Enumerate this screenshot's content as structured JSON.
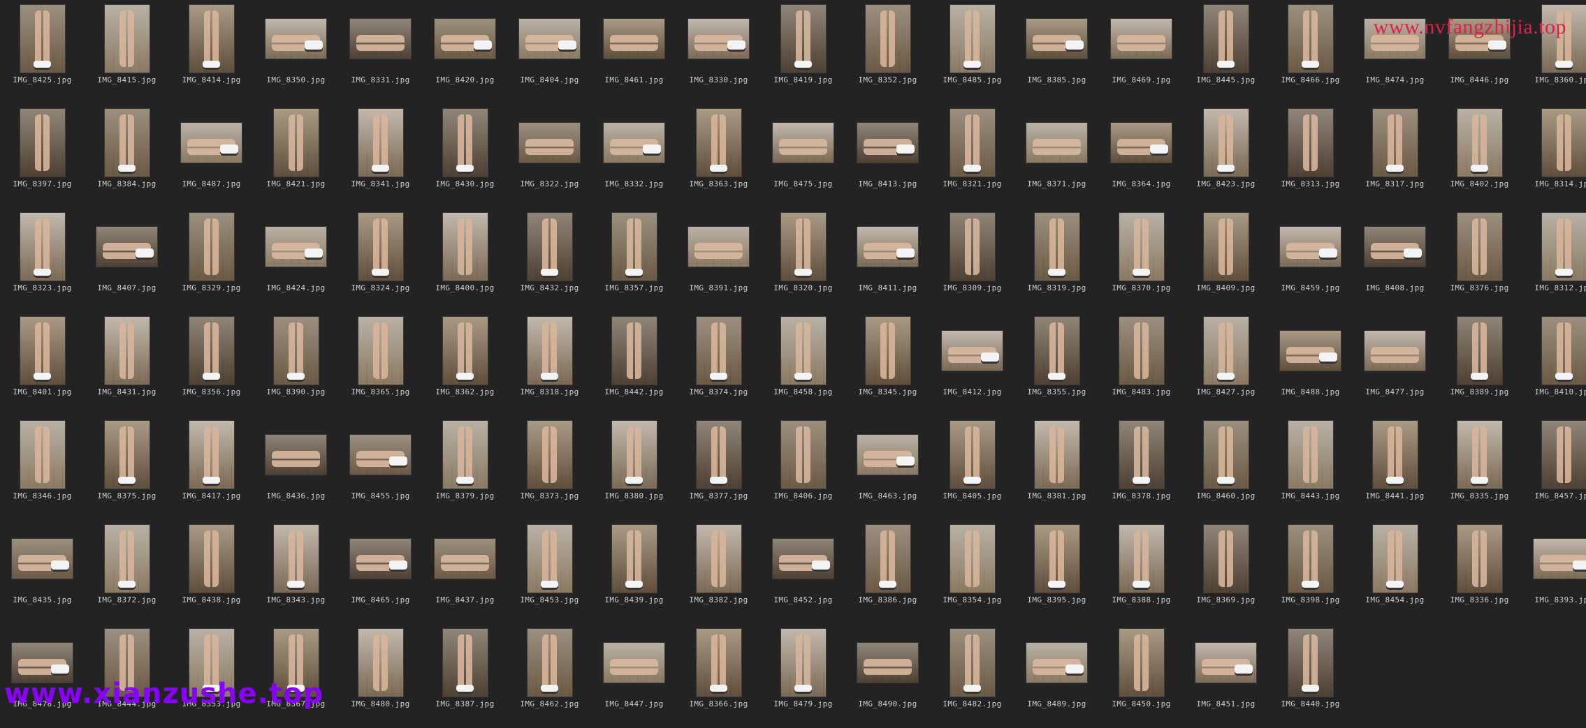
{
  "watermarks": {
    "top_right": "www.nvfangzhijia.top",
    "bottom_left": "www.xianzushe.top"
  },
  "colors": {
    "background": "#232323",
    "label_text": "#cfcfcf",
    "watermark_top": "#e0204a",
    "watermark_bottom": "#8a00ff"
  },
  "files": [
    {
      "name": "IMG_8425.jpg",
      "orientation": "portrait"
    },
    {
      "name": "IMG_8415.jpg",
      "orientation": "portrait"
    },
    {
      "name": "IMG_8414.jpg",
      "orientation": "portrait"
    },
    {
      "name": "IMG_8350.jpg",
      "orientation": "landscape"
    },
    {
      "name": "IMG_8331.jpg",
      "orientation": "landscape"
    },
    {
      "name": "IMG_8420.jpg",
      "orientation": "landscape"
    },
    {
      "name": "IMG_8404.jpg",
      "orientation": "landscape"
    },
    {
      "name": "IMG_8461.jpg",
      "orientation": "landscape"
    },
    {
      "name": "IMG_8330.jpg",
      "orientation": "landscape"
    },
    {
      "name": "IMG_8419.jpg",
      "orientation": "portrait"
    },
    {
      "name": "IMG_8352.jpg",
      "orientation": "portrait"
    },
    {
      "name": "IMG_8485.jpg",
      "orientation": "portrait"
    },
    {
      "name": "IMG_8385.jpg",
      "orientation": "landscape"
    },
    {
      "name": "IMG_8469.jpg",
      "orientation": "landscape"
    },
    {
      "name": "IMG_8445.jpg",
      "orientation": "portrait"
    },
    {
      "name": "IMG_8466.jpg",
      "orientation": "portrait"
    },
    {
      "name": "IMG_8474.jpg",
      "orientation": "landscape"
    },
    {
      "name": "IMG_8446.jpg",
      "orientation": "landscape"
    },
    {
      "name": "IMG_8360.jpg",
      "orientation": "portrait"
    },
    {
      "name": "IMG_8397.jpg",
      "orientation": "portrait"
    },
    {
      "name": "IMG_8384.jpg",
      "orientation": "portrait"
    },
    {
      "name": "IMG_8487.jpg",
      "orientation": "landscape"
    },
    {
      "name": "IMG_8421.jpg",
      "orientation": "portrait"
    },
    {
      "name": "IMG_8341.jpg",
      "orientation": "portrait"
    },
    {
      "name": "IMG_8430.jpg",
      "orientation": "portrait"
    },
    {
      "name": "IMG_8322.jpg",
      "orientation": "landscape"
    },
    {
      "name": "IMG_8332.jpg",
      "orientation": "landscape"
    },
    {
      "name": "IMG_8363.jpg",
      "orientation": "portrait"
    },
    {
      "name": "IMG_8475.jpg",
      "orientation": "landscape"
    },
    {
      "name": "IMG_8413.jpg",
      "orientation": "landscape"
    },
    {
      "name": "IMG_8321.jpg",
      "orientation": "portrait"
    },
    {
      "name": "IMG_8371.jpg",
      "orientation": "landscape"
    },
    {
      "name": "IMG_8364.jpg",
      "orientation": "landscape"
    },
    {
      "name": "IMG_8423.jpg",
      "orientation": "portrait"
    },
    {
      "name": "IMG_8313.jpg",
      "orientation": "portrait"
    },
    {
      "name": "IMG_8317.jpg",
      "orientation": "portrait"
    },
    {
      "name": "IMG_8402.jpg",
      "orientation": "portrait"
    },
    {
      "name": "IMG_8314.jpg",
      "orientation": "portrait"
    },
    {
      "name": "IMG_8323.jpg",
      "orientation": "portrait"
    },
    {
      "name": "IMG_8407.jpg",
      "orientation": "landscape"
    },
    {
      "name": "IMG_8329.jpg",
      "orientation": "portrait"
    },
    {
      "name": "IMG_8424.jpg",
      "orientation": "landscape"
    },
    {
      "name": "IMG_8324.jpg",
      "orientation": "portrait"
    },
    {
      "name": "IMG_8400.jpg",
      "orientation": "portrait"
    },
    {
      "name": "IMG_8432.jpg",
      "orientation": "portrait"
    },
    {
      "name": "IMG_8357.jpg",
      "orientation": "portrait"
    },
    {
      "name": "IMG_8391.jpg",
      "orientation": "landscape"
    },
    {
      "name": "IMG_8320.jpg",
      "orientation": "portrait"
    },
    {
      "name": "IMG_8411.jpg",
      "orientation": "landscape"
    },
    {
      "name": "IMG_8309.jpg",
      "orientation": "portrait"
    },
    {
      "name": "IMG_8319.jpg",
      "orientation": "portrait"
    },
    {
      "name": "IMG_8370.jpg",
      "orientation": "portrait"
    },
    {
      "name": "IMG_8409.jpg",
      "orientation": "portrait"
    },
    {
      "name": "IMG_8459.jpg",
      "orientation": "landscape"
    },
    {
      "name": "IMG_8408.jpg",
      "orientation": "landscape"
    },
    {
      "name": "IMG_8376.jpg",
      "orientation": "portrait"
    },
    {
      "name": "IMG_8312.jpg",
      "orientation": "portrait"
    },
    {
      "name": "IMG_8401.jpg",
      "orientation": "portrait"
    },
    {
      "name": "IMG_8431.jpg",
      "orientation": "portrait"
    },
    {
      "name": "IMG_8356.jpg",
      "orientation": "portrait"
    },
    {
      "name": "IMG_8390.jpg",
      "orientation": "portrait"
    },
    {
      "name": "IMG_8365.jpg",
      "orientation": "portrait"
    },
    {
      "name": "IMG_8362.jpg",
      "orientation": "portrait"
    },
    {
      "name": "IMG_8318.jpg",
      "orientation": "portrait"
    },
    {
      "name": "IMG_8442.jpg",
      "orientation": "portrait"
    },
    {
      "name": "IMG_8374.jpg",
      "orientation": "portrait"
    },
    {
      "name": "IMG_8458.jpg",
      "orientation": "portrait"
    },
    {
      "name": "IMG_8345.jpg",
      "orientation": "portrait"
    },
    {
      "name": "IMG_8412.jpg",
      "orientation": "landscape"
    },
    {
      "name": "IMG_8355.jpg",
      "orientation": "portrait"
    },
    {
      "name": "IMG_8483.jpg",
      "orientation": "portrait"
    },
    {
      "name": "IMG_8427.jpg",
      "orientation": "portrait"
    },
    {
      "name": "IMG_8488.jpg",
      "orientation": "landscape"
    },
    {
      "name": "IMG_8477.jpg",
      "orientation": "landscape"
    },
    {
      "name": "IMG_8389.jpg",
      "orientation": "portrait"
    },
    {
      "name": "IMG_8410.jpg",
      "orientation": "portrait"
    },
    {
      "name": "IMG_8346.jpg",
      "orientation": "portrait"
    },
    {
      "name": "IMG_8375.jpg",
      "orientation": "portrait"
    },
    {
      "name": "IMG_8417.jpg",
      "orientation": "portrait"
    },
    {
      "name": "IMG_8436.jpg",
      "orientation": "landscape"
    },
    {
      "name": "IMG_8455.jpg",
      "orientation": "landscape"
    },
    {
      "name": "IMG_8379.jpg",
      "orientation": "portrait"
    },
    {
      "name": "IMG_8373.jpg",
      "orientation": "portrait"
    },
    {
      "name": "IMG_8380.jpg",
      "orientation": "portrait"
    },
    {
      "name": "IMG_8377.jpg",
      "orientation": "portrait"
    },
    {
      "name": "IMG_8406.jpg",
      "orientation": "portrait"
    },
    {
      "name": "IMG_8463.jpg",
      "orientation": "landscape"
    },
    {
      "name": "IMG_8405.jpg",
      "orientation": "portrait"
    },
    {
      "name": "IMG_8381.jpg",
      "orientation": "portrait"
    },
    {
      "name": "IMG_8378.jpg",
      "orientation": "portrait"
    },
    {
      "name": "IMG_8460.jpg",
      "orientation": "portrait"
    },
    {
      "name": "IMG_8443.jpg",
      "orientation": "portrait"
    },
    {
      "name": "IMG_8441.jpg",
      "orientation": "portrait"
    },
    {
      "name": "IMG_8335.jpg",
      "orientation": "portrait"
    },
    {
      "name": "IMG_8457.jpg",
      "orientation": "portrait"
    },
    {
      "name": "IMG_8435.jpg",
      "orientation": "landscape"
    },
    {
      "name": "IMG_8372.jpg",
      "orientation": "portrait"
    },
    {
      "name": "IMG_8438.jpg",
      "orientation": "portrait"
    },
    {
      "name": "IMG_8343.jpg",
      "orientation": "portrait"
    },
    {
      "name": "IMG_8465.jpg",
      "orientation": "landscape"
    },
    {
      "name": "IMG_8437.jpg",
      "orientation": "landscape"
    },
    {
      "name": "IMG_8453.jpg",
      "orientation": "portrait"
    },
    {
      "name": "IMG_8439.jpg",
      "orientation": "portrait"
    },
    {
      "name": "IMG_8382.jpg",
      "orientation": "portrait"
    },
    {
      "name": "IMG_8452.jpg",
      "orientation": "landscape"
    },
    {
      "name": "IMG_8386.jpg",
      "orientation": "portrait"
    },
    {
      "name": "IMG_8354.jpg",
      "orientation": "portrait"
    },
    {
      "name": "IMG_8395.jpg",
      "orientation": "portrait"
    },
    {
      "name": "IMG_8388.jpg",
      "orientation": "portrait"
    },
    {
      "name": "IMG_8369.jpg",
      "orientation": "portrait"
    },
    {
      "name": "IMG_8398.jpg",
      "orientation": "portrait"
    },
    {
      "name": "IMG_8454.jpg",
      "orientation": "portrait"
    },
    {
      "name": "IMG_8336.jpg",
      "orientation": "portrait"
    },
    {
      "name": "IMG_8393.jpg",
      "orientation": "landscape"
    },
    {
      "name": "IMG_8478.jpg",
      "orientation": "landscape"
    },
    {
      "name": "IMG_8444.jpg",
      "orientation": "portrait"
    },
    {
      "name": "IMG_8353.jpg",
      "orientation": "portrait"
    },
    {
      "name": "IMG_8367.jpg",
      "orientation": "portrait"
    },
    {
      "name": "IMG_8480.jpg",
      "orientation": "portrait"
    },
    {
      "name": "IMG_8387.jpg",
      "orientation": "portrait"
    },
    {
      "name": "IMG_8462.jpg",
      "orientation": "portrait"
    },
    {
      "name": "IMG_8447.jpg",
      "orientation": "landscape"
    },
    {
      "name": "IMG_8366.jpg",
      "orientation": "portrait"
    },
    {
      "name": "IMG_8479.jpg",
      "orientation": "portrait"
    },
    {
      "name": "IMG_8490.jpg",
      "orientation": "landscape"
    },
    {
      "name": "IMG_8482.jpg",
      "orientation": "portrait"
    },
    {
      "name": "IMG_8489.jpg",
      "orientation": "landscape"
    },
    {
      "name": "IMG_8450.jpg",
      "orientation": "portrait"
    },
    {
      "name": "IMG_8451.jpg",
      "orientation": "landscape"
    },
    {
      "name": "IMG_8440.jpg",
      "orientation": "portrait"
    }
  ]
}
